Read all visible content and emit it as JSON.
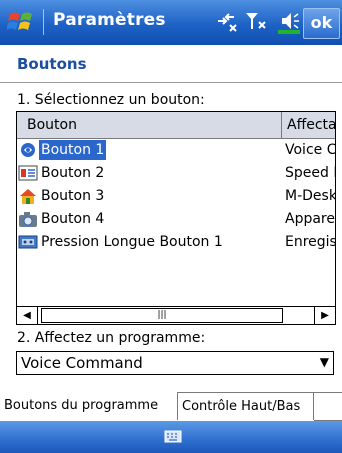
{
  "titlebar": {
    "title": "Paramètres",
    "ok_label": "ok"
  },
  "page": {
    "header": "Boutons",
    "step1_label": "1. Sélectionnez un bouton:",
    "step2_label": "2. Affectez un programme:"
  },
  "list": {
    "columns": [
      "Bouton",
      "Affectati"
    ],
    "rows": [
      {
        "name": "Bouton 1",
        "value": "Voice Co",
        "icon": "voice-icon",
        "selected": true
      },
      {
        "name": "Bouton 2",
        "value": "Speed Di",
        "icon": "speed-dial-icon",
        "selected": false
      },
      {
        "name": "Bouton 3",
        "value": "M-Desk",
        "icon": "home-icon",
        "selected": false
      },
      {
        "name": "Bouton 4",
        "value": "Appareil",
        "icon": "camera-icon",
        "selected": false
      },
      {
        "name": "Pression Longue Bouton 1",
        "value": "Enregistr",
        "icon": "recorder-icon",
        "selected": false
      }
    ]
  },
  "program_select": {
    "value": "Voice Command"
  },
  "tabs": [
    {
      "label": "Boutons du programme",
      "active": true
    },
    {
      "label": "Contrôle Haut/Bas",
      "active": false
    }
  ],
  "colors": {
    "title_bar": "#1e62c6",
    "header_text": "#1d4f9e",
    "selection": "#2b66cc"
  }
}
